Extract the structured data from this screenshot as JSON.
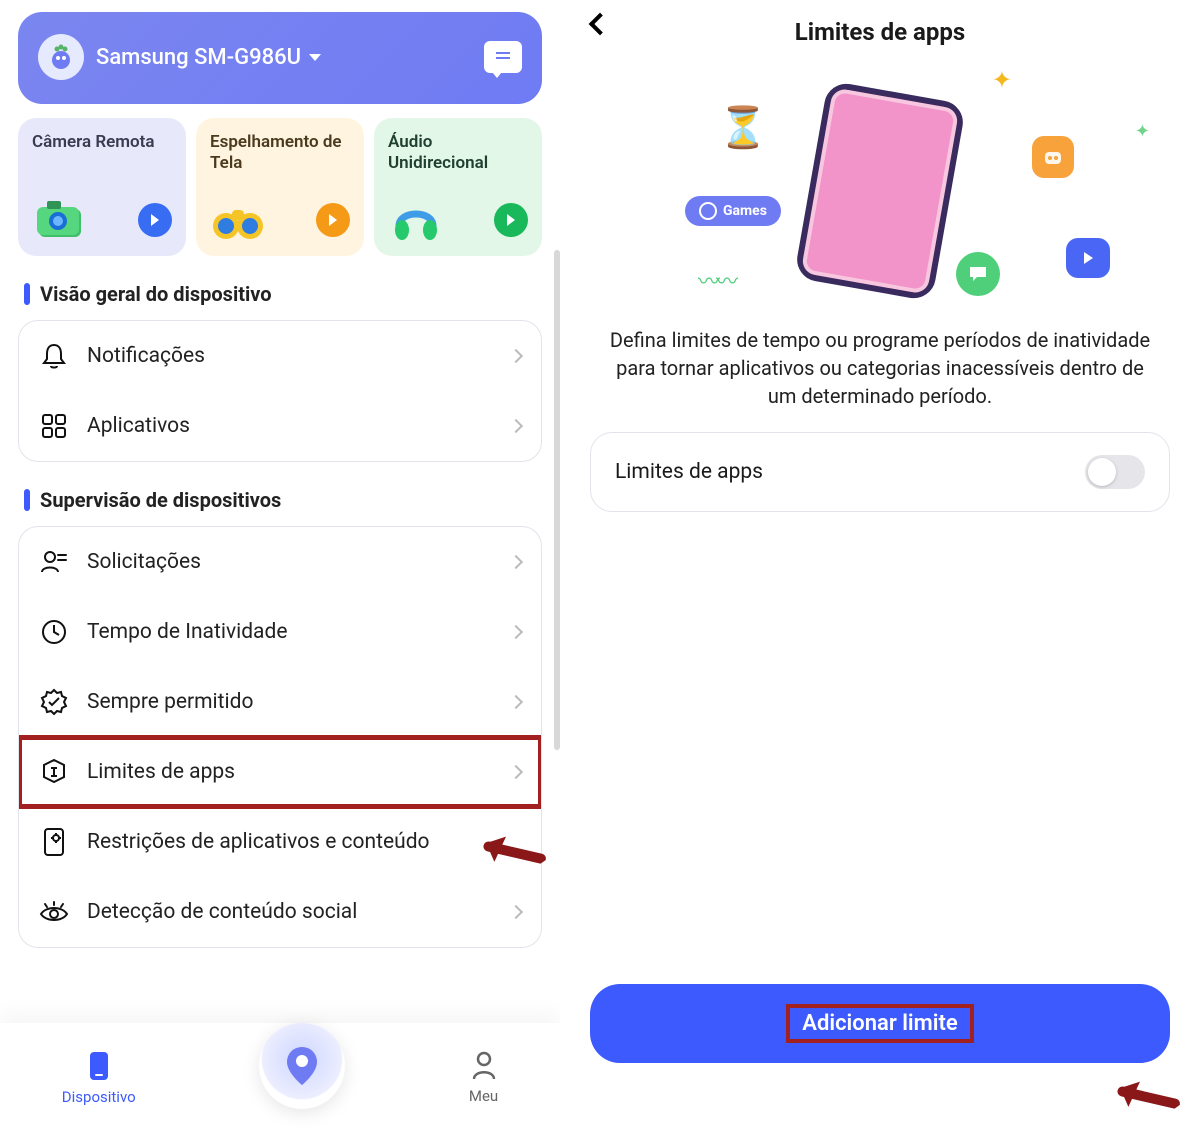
{
  "left": {
    "header": {
      "device_name": "Samsung SM-G986U"
    },
    "features": {
      "camera": "Câmera Remota",
      "mirror": "Espelhamento de Tela",
      "audio": "Áudio Unidirecional"
    },
    "section_overview": "Visão geral do dispositivo",
    "overview_items": {
      "notifications": "Notificações",
      "apps": "Aplicativos"
    },
    "section_supervision": "Supervisão de dispositivos",
    "supervision_items": {
      "requests": "Solicitações",
      "downtime": "Tempo de Inatividade",
      "always_allowed": "Sempre permitido",
      "app_limits": "Limites de apps",
      "restrictions": "Restrições de aplicativos e conteúdo",
      "social": "Detecção de conteúdo social"
    },
    "nav": {
      "device": "Dispositivo",
      "me": "Meu"
    }
  },
  "right": {
    "title": "Limites de apps",
    "games_pill": "Games",
    "description": "Defina limites de tempo ou programe períodos de inatividade para tornar aplicativos ou categorias inacessíveis dentro de um determinado período.",
    "toggle_label": "Limites de apps",
    "primary_button": "Adicionar limite"
  }
}
